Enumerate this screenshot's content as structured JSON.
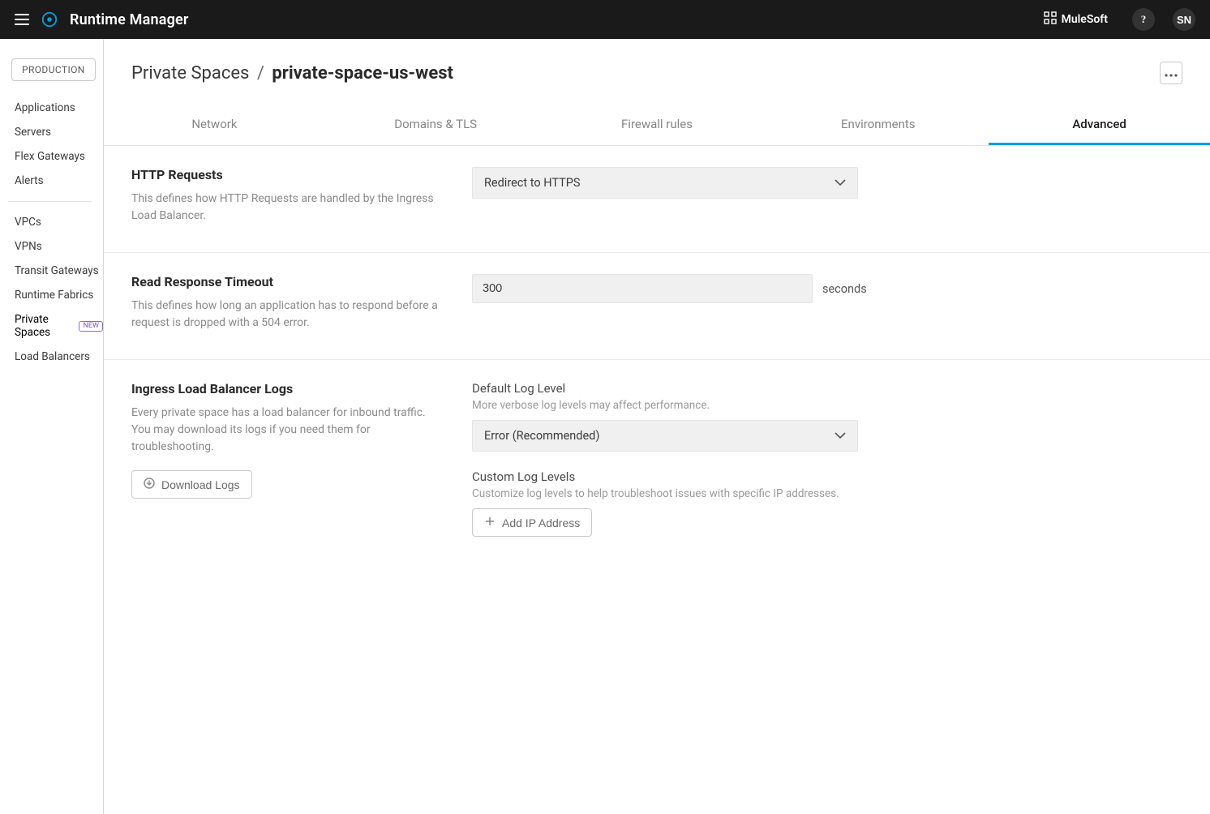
{
  "topbar": {
    "app_title": "Runtime Manager",
    "brand": "MuleSoft",
    "help_glyph": "?",
    "avatar_initials": "SN"
  },
  "sidebar": {
    "environment": "PRODUCTION",
    "group1": [
      {
        "label": "Applications"
      },
      {
        "label": "Servers"
      },
      {
        "label": "Flex Gateways"
      },
      {
        "label": "Alerts"
      }
    ],
    "group2": [
      {
        "label": "VPCs"
      },
      {
        "label": "VPNs"
      },
      {
        "label": "Transit Gateways"
      },
      {
        "label": "Runtime Fabrics"
      },
      {
        "label": "Private Spaces",
        "new": true
      },
      {
        "label": "Load Balancers"
      }
    ],
    "new_pill": "NEW"
  },
  "breadcrumb": {
    "parent": "Private Spaces",
    "separator": "/",
    "current": "private-space-us-west"
  },
  "tabs": [
    {
      "id": "network",
      "label": "Network",
      "active": false
    },
    {
      "id": "domains",
      "label": "Domains & TLS",
      "active": false
    },
    {
      "id": "firewall",
      "label": "Firewall rules",
      "active": false
    },
    {
      "id": "environments",
      "label": "Environments",
      "active": false
    },
    {
      "id": "advanced",
      "label": "Advanced",
      "active": true
    }
  ],
  "http": {
    "title": "HTTP Requests",
    "desc": "This defines how HTTP Requests are handled by the Ingress Load Balancer.",
    "select_value": "Redirect to HTTPS"
  },
  "timeout": {
    "title": "Read Response Timeout",
    "desc": "This defines how long an application has to respond before a request is dropped with a 504 error.",
    "value": "300",
    "unit": "seconds"
  },
  "logs": {
    "title": "Ingress Load Balancer Logs",
    "desc": "Every private space has a load balancer for inbound traffic. You may download its logs if you need them for troubleshooting.",
    "download_btn": "Download Logs",
    "default_level": {
      "label": "Default Log Level",
      "hint": "More verbose log levels may affect performance.",
      "value": "Error (Recommended)"
    },
    "custom_levels": {
      "label": "Custom Log Levels",
      "hint": "Customize log levels to help troubleshoot issues with specific IP addresses.",
      "add_btn": "Add IP Address"
    }
  }
}
